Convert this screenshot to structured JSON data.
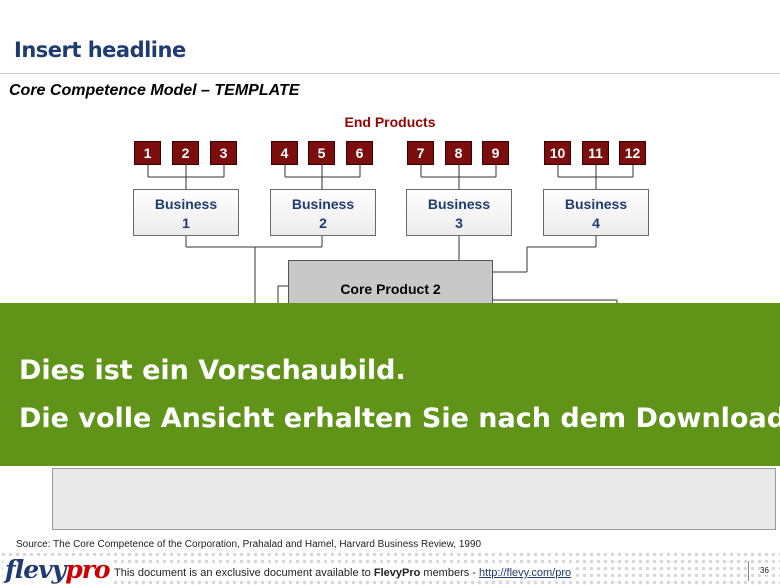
{
  "headline": "Insert headline",
  "subtitle": "Core Competence Model – TEMPLATE",
  "diagram": {
    "end_products_label": "End Products",
    "products": [
      "1",
      "2",
      "3",
      "4",
      "5",
      "6",
      "7",
      "8",
      "9",
      "10",
      "11",
      "12"
    ],
    "businesses": [
      {
        "name": "Business",
        "number": "1"
      },
      {
        "name": "Business",
        "number": "2"
      },
      {
        "name": "Business",
        "number": "3"
      },
      {
        "name": "Business",
        "number": "4"
      }
    ],
    "core_product": "Core Product 2"
  },
  "banner": {
    "line1": "Dies ist ein Vorschaubild.",
    "line2": "Die volle Ansicht erhalten Sie nach dem Download."
  },
  "source": "Source: The Core Competence of the Corporation, Prahalad and Hamel, Harvard Business Review, 1990",
  "footer": {
    "logo_main": "flevy",
    "logo_accent": "pro",
    "text_before": "This document is an exclusive document available to",
    "brand": "FlevyPro",
    "text_middle": "members -",
    "link": "http://flevy.com/pro",
    "page": "36"
  },
  "colors": {
    "product_fill": "#7b0d0d",
    "headline": "#1f3b73",
    "banner": "#5f9418",
    "end_products_label": "#990000"
  }
}
